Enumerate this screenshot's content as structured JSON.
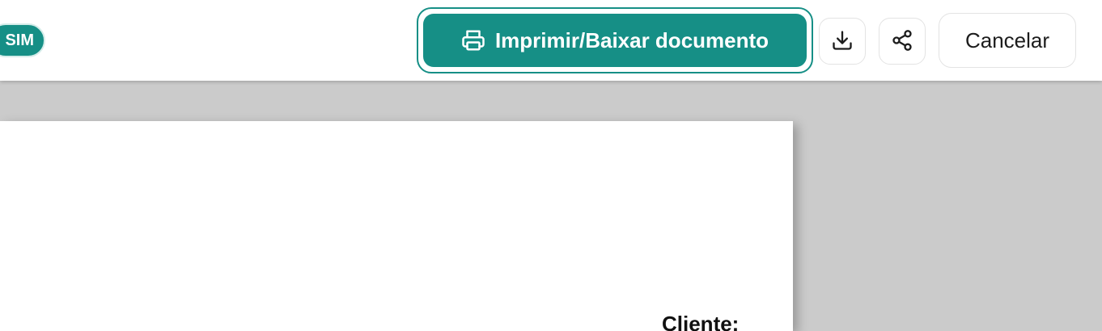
{
  "header": {
    "badge_label": "SIM",
    "print_button_label": "Imprimir/Baixar documento",
    "print_icon": "printer-icon",
    "download_icon": "download-icon",
    "share_icon": "share-icon",
    "cancel_button_label": "Cancelar"
  },
  "document": {
    "client_label": "Cliente:"
  },
  "colors": {
    "accent": "#168f86",
    "workspace_bg": "#cbcbcb",
    "page_bg": "#ffffff"
  }
}
